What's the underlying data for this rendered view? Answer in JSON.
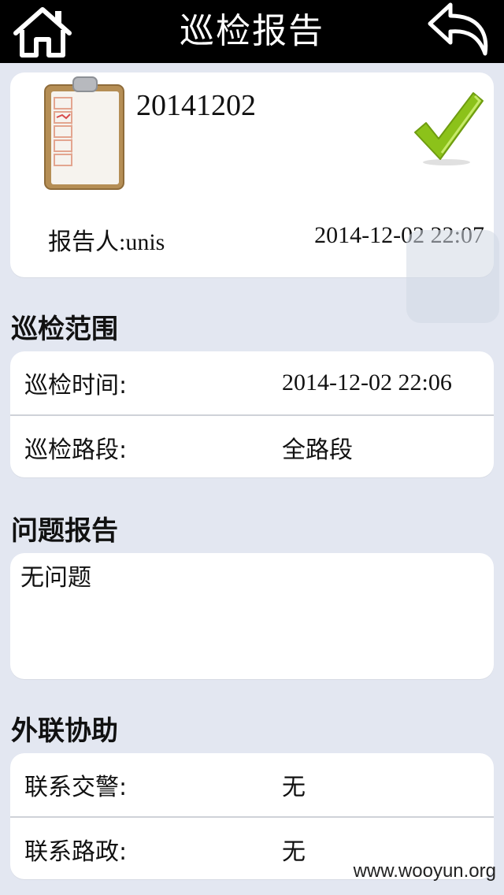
{
  "header": {
    "title": "巡检报告",
    "home_icon": "home-icon",
    "back_icon": "back-arrow-icon"
  },
  "report": {
    "id": "20141202",
    "reporter": "报告人:unis",
    "time": "2014-12-02 22:07",
    "status_icon": "checkmark-icon",
    "doc_icon": "clipboard-icon"
  },
  "scope": {
    "title": "巡检范围",
    "rows": [
      {
        "label": "巡检时间:",
        "value": "2014-12-02 22:06"
      },
      {
        "label": "巡检路段:",
        "value": "全路段"
      }
    ]
  },
  "problem": {
    "title": "问题报告",
    "text": "无问题"
  },
  "assist": {
    "title": "外联协助",
    "rows": [
      {
        "label": "联系交警:",
        "value": "无"
      },
      {
        "label": "联系路政:",
        "value": "无"
      }
    ]
  },
  "watermark": "www.wooyun.org",
  "colors": {
    "background": "#e3e7f1",
    "topbar": "#000000",
    "check": "#8cc21a"
  }
}
